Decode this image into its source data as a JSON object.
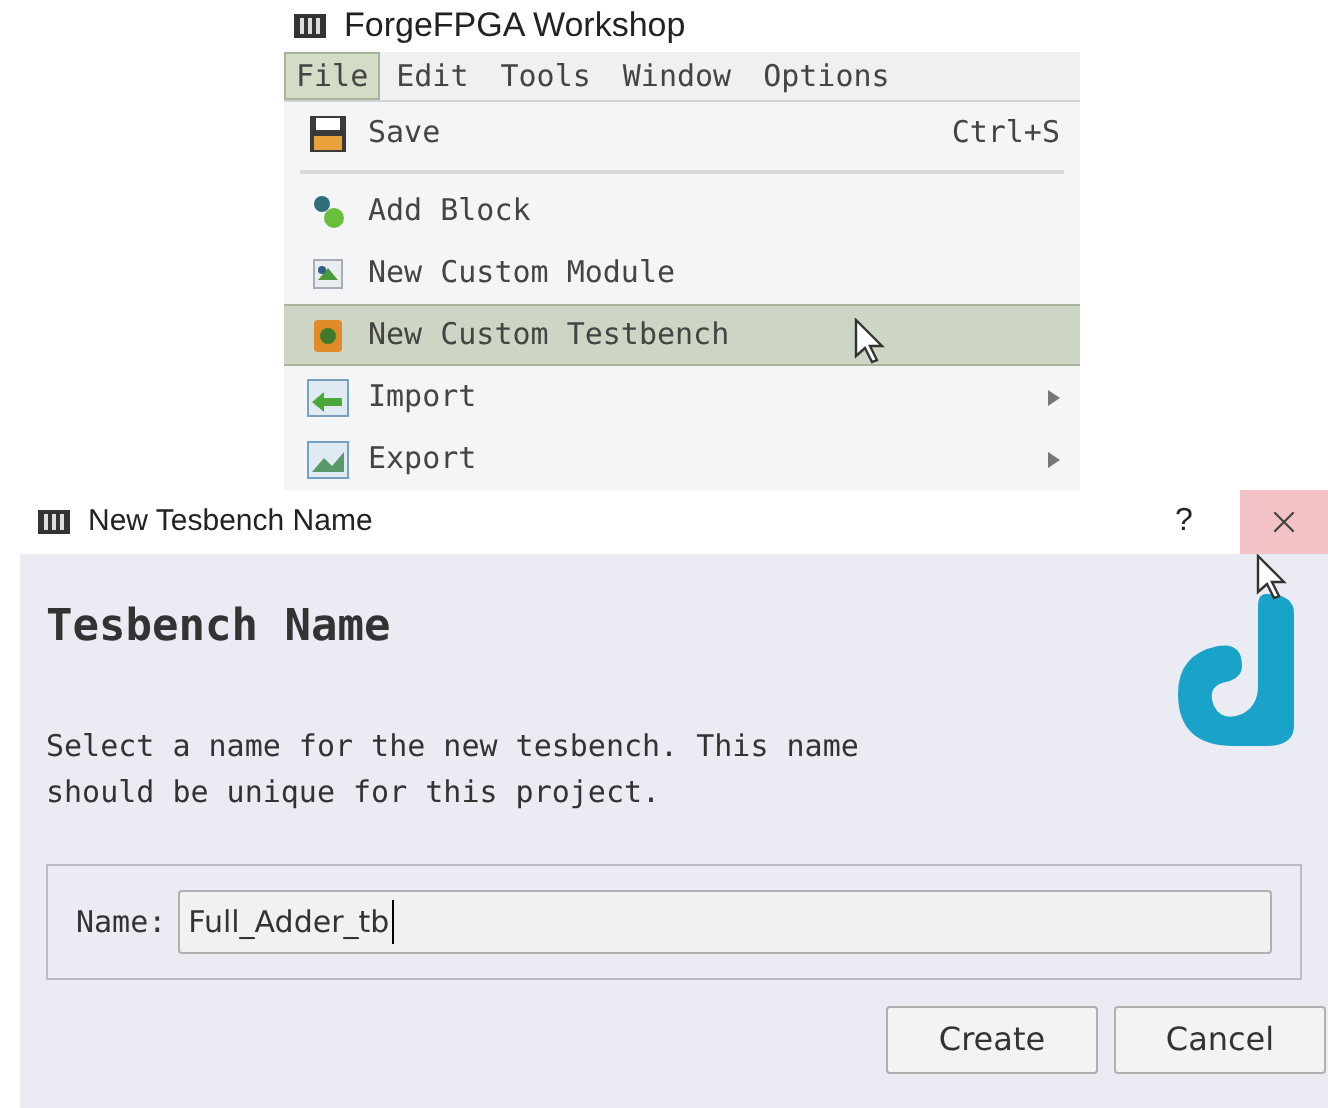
{
  "app_window": {
    "title": "ForgeFPGA Workshop",
    "menu_bar": [
      {
        "label": "File",
        "selected": true
      },
      {
        "label": "Edit",
        "selected": false
      },
      {
        "label": "Tools",
        "selected": false
      },
      {
        "label": "Window",
        "selected": false
      },
      {
        "label": "Options",
        "selected": false
      }
    ],
    "file_menu": [
      {
        "kind": "item",
        "label": "Save",
        "shortcut": "Ctrl+S",
        "selected": false,
        "has_submenu": false
      },
      {
        "kind": "separator"
      },
      {
        "kind": "item",
        "label": "Add Block",
        "selected": false,
        "has_submenu": false
      },
      {
        "kind": "item",
        "label": "New Custom Module",
        "selected": false,
        "has_submenu": false
      },
      {
        "kind": "item",
        "label": "New Custom Testbench",
        "selected": true,
        "has_submenu": false
      },
      {
        "kind": "item",
        "label": "Import",
        "selected": false,
        "has_submenu": true
      },
      {
        "kind": "item",
        "label": "Export",
        "selected": false,
        "has_submenu": true
      }
    ]
  },
  "dialog": {
    "title": "New Tesbench Name",
    "help": "?",
    "close_hovered": true,
    "heading": "Tesbench Name",
    "description": "Select a name for the new tesbench. This name should be unique for this project.",
    "name_field": {
      "label": "Name:",
      "value": "Full_Adder_tb"
    },
    "buttons": [
      "Create",
      "Cancel"
    ]
  }
}
